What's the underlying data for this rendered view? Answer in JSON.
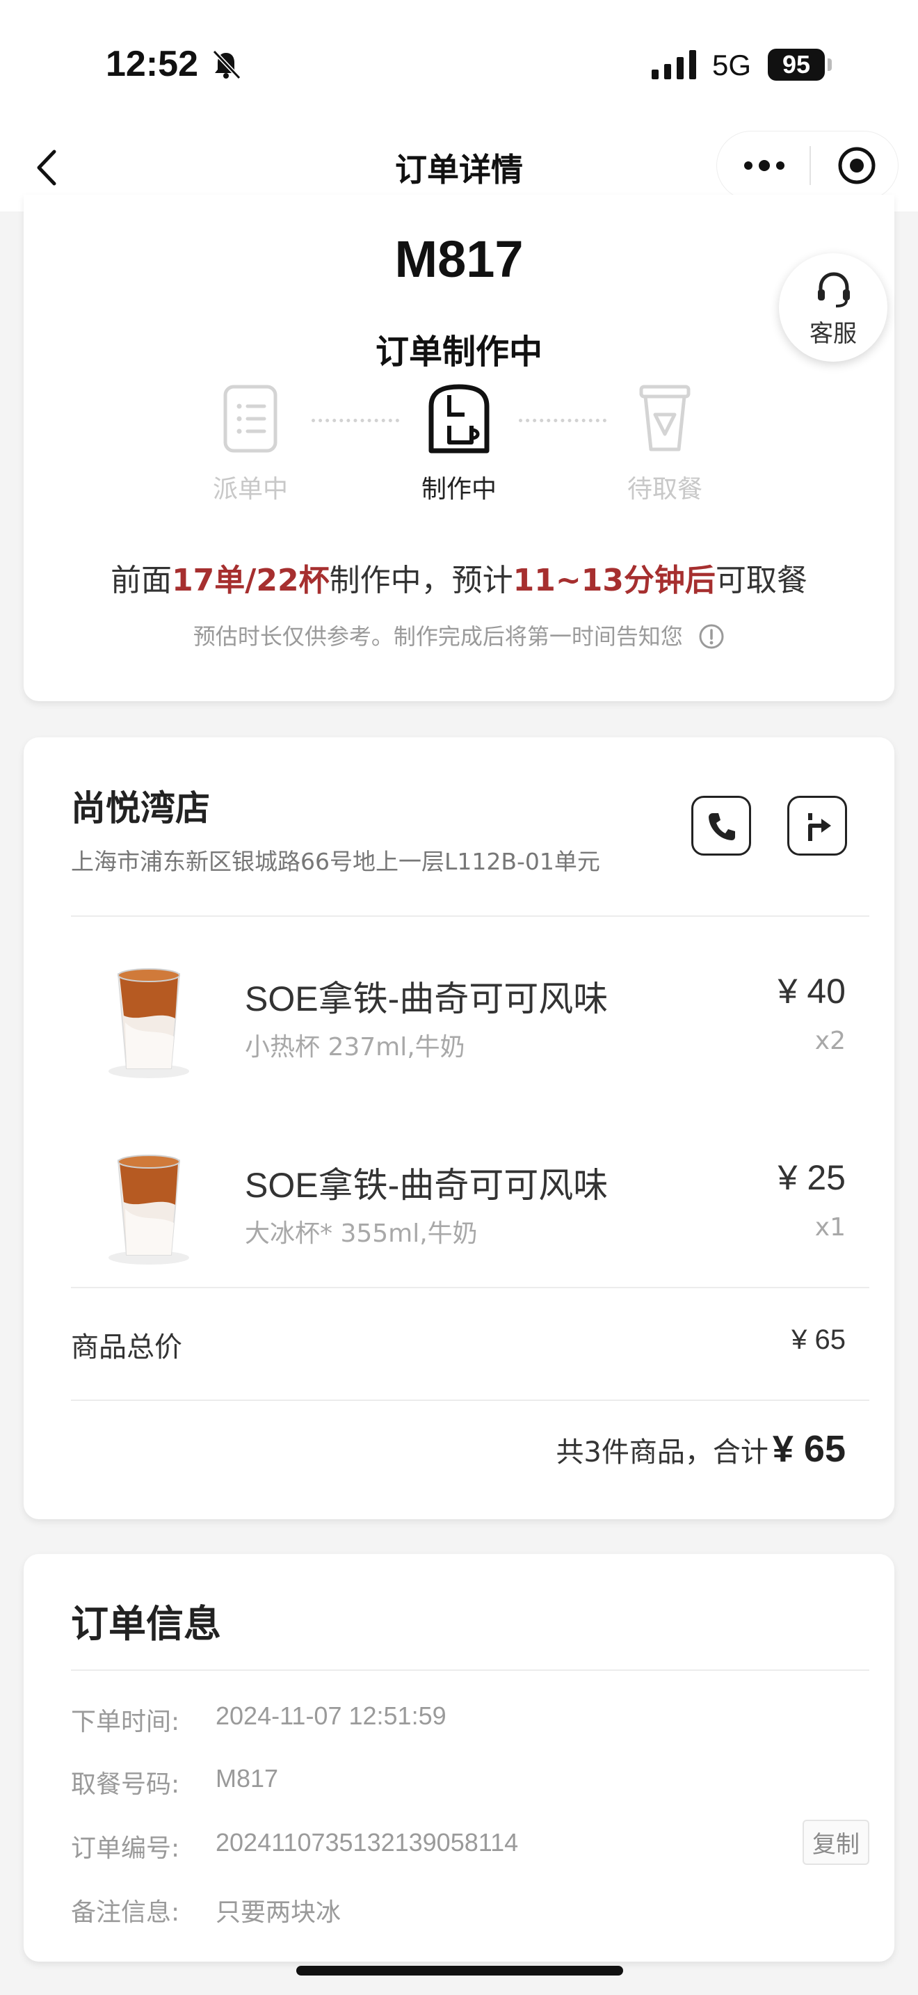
{
  "status_bar": {
    "time": "12:52",
    "network": "5G",
    "battery": "95"
  },
  "nav": {
    "title": "订单详情"
  },
  "order_status": {
    "pickup_code": "M817",
    "title": "订单制作中",
    "steps": [
      {
        "label": "派单中",
        "icon": "order-list-icon",
        "active": false
      },
      {
        "label": "制作中",
        "icon": "coffee-machine-icon",
        "active": true
      },
      {
        "label": "待取餐",
        "icon": "cup-icon",
        "active": false
      }
    ],
    "eta": {
      "prefix": "前面",
      "queue": "17单/22杯",
      "middle": "制作中，预计",
      "time": "11~13分钟后",
      "suffix": "可取餐"
    },
    "note": "预估时长仅供参考。制作完成后将第一时间告知您"
  },
  "service": {
    "label": "客服"
  },
  "store": {
    "name": "尚悦湾店",
    "address": "上海市浦东新区银城路66号地上一层L112B-01单元",
    "items": [
      {
        "name": "SOE拿铁-曲奇可可风味",
        "spec": "小热杯 237ml,牛奶",
        "price": "¥ 40",
        "qty": "x2"
      },
      {
        "name": "SOE拿铁-曲奇可可风味",
        "spec": "大冰杯* 355ml,牛奶",
        "price": "¥ 25",
        "qty": "x1"
      }
    ],
    "subtotal_label": "商品总价",
    "subtotal_value": "¥ 65",
    "total_prefix": "共3件商品，合计",
    "total_amount": "¥ 65"
  },
  "order_info": {
    "title": "订单信息",
    "rows": [
      {
        "label": "下单时间:",
        "value": "2024-11-07 12:51:59"
      },
      {
        "label": "取餐号码:",
        "value": "M817"
      },
      {
        "label": "订单编号:",
        "value": "2024110735132139058114"
      },
      {
        "label": "备注信息:",
        "value": "只要两块冰"
      }
    ],
    "copy_label": "复制"
  },
  "colors": {
    "highlight": "#a62f2f",
    "background": "#f4f4f4"
  }
}
